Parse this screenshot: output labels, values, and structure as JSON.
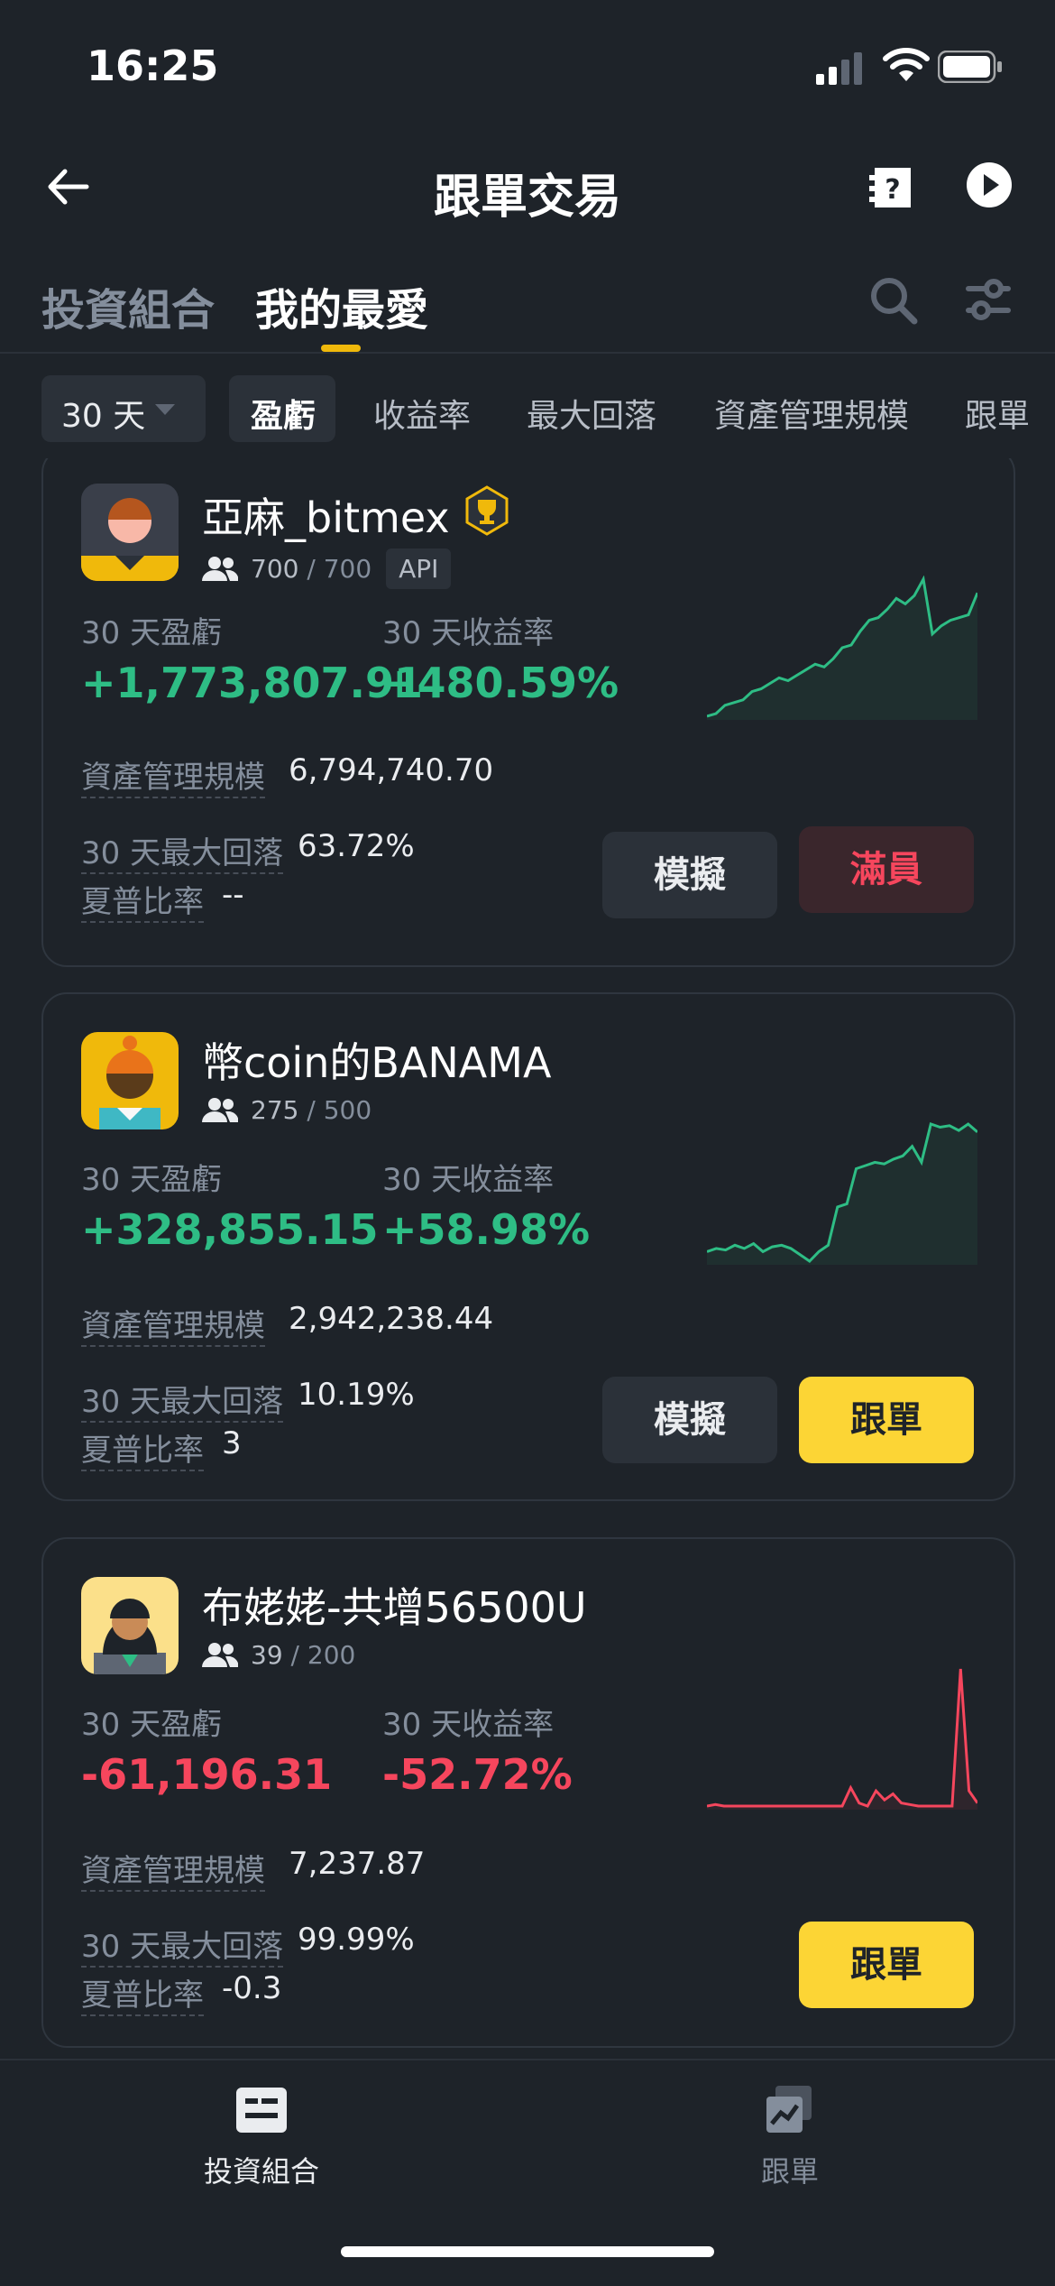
{
  "status": {
    "time": "16:25"
  },
  "header": {
    "title": "跟單交易"
  },
  "tabs": [
    {
      "label": "投資組合"
    },
    {
      "label": "我的最愛"
    }
  ],
  "filters": {
    "period": "30 天",
    "chips": [
      "盈虧",
      "收益率",
      "最大回落",
      "資產管理規模",
      "跟單"
    ]
  },
  "labels": {
    "pnl": "30 天盈虧",
    "roi": "30 天收益率",
    "aum": "資產管理規模",
    "mdd": "30 天最大回落",
    "sharpe": "夏普比率"
  },
  "traders": [
    {
      "name": "亞麻_bitmex",
      "followers": "700",
      "max_followers": "/ 700",
      "badge": "API",
      "pnl": "+1,773,807.91",
      "roi": "+480.59%",
      "aum": "6,794,740.70",
      "mdd": "63.72%",
      "sharpe": "--",
      "buttons": [
        "模擬",
        "滿員"
      ],
      "spark_color": "#2ebd85",
      "spark": [
        10,
        12,
        18,
        20,
        22,
        28,
        30,
        34,
        38,
        36,
        40,
        44,
        48,
        46,
        52,
        60,
        62,
        72,
        80,
        82,
        88,
        96,
        92,
        98,
        110,
        70,
        76,
        80,
        82,
        84,
        100
      ]
    },
    {
      "name": "幣coin的BANAMA",
      "followers": "275",
      "max_followers": "/ 500",
      "buttons": [
        "模擬",
        "跟單"
      ],
      "pnl": "+328,855.15",
      "roi": "+58.98%",
      "aum": "2,942,238.44",
      "mdd": "10.19%",
      "sharpe": "3",
      "spark_color": "#2ebd85",
      "spark": [
        20,
        22,
        21,
        24,
        22,
        25,
        20,
        23,
        24,
        22,
        18,
        14,
        20,
        24,
        48,
        50,
        72,
        74,
        76,
        75,
        78,
        80,
        86,
        76,
        100,
        98,
        99,
        96,
        100,
        95
      ]
    },
    {
      "name": "布姥姥-共增56500U",
      "followers": "39",
      "max_followers": "/ 200",
      "buttons": [
        "跟單"
      ],
      "pnl": "-61,196.31",
      "roi": "-52.72%",
      "aum": "7,237.87",
      "mdd": "99.99%",
      "sharpe": "-0.3",
      "spark_color": "#f6465d",
      "spark": [
        10,
        11,
        10,
        10,
        10,
        10,
        10,
        10,
        10,
        10,
        10,
        10,
        10,
        10,
        10,
        10,
        10,
        22,
        12,
        10,
        20,
        14,
        18,
        12,
        11,
        10,
        10,
        10,
        10,
        10,
        100,
        20,
        12
      ]
    }
  ],
  "bottom_nav": [
    {
      "label": "投資組合"
    },
    {
      "label": "跟單"
    }
  ]
}
